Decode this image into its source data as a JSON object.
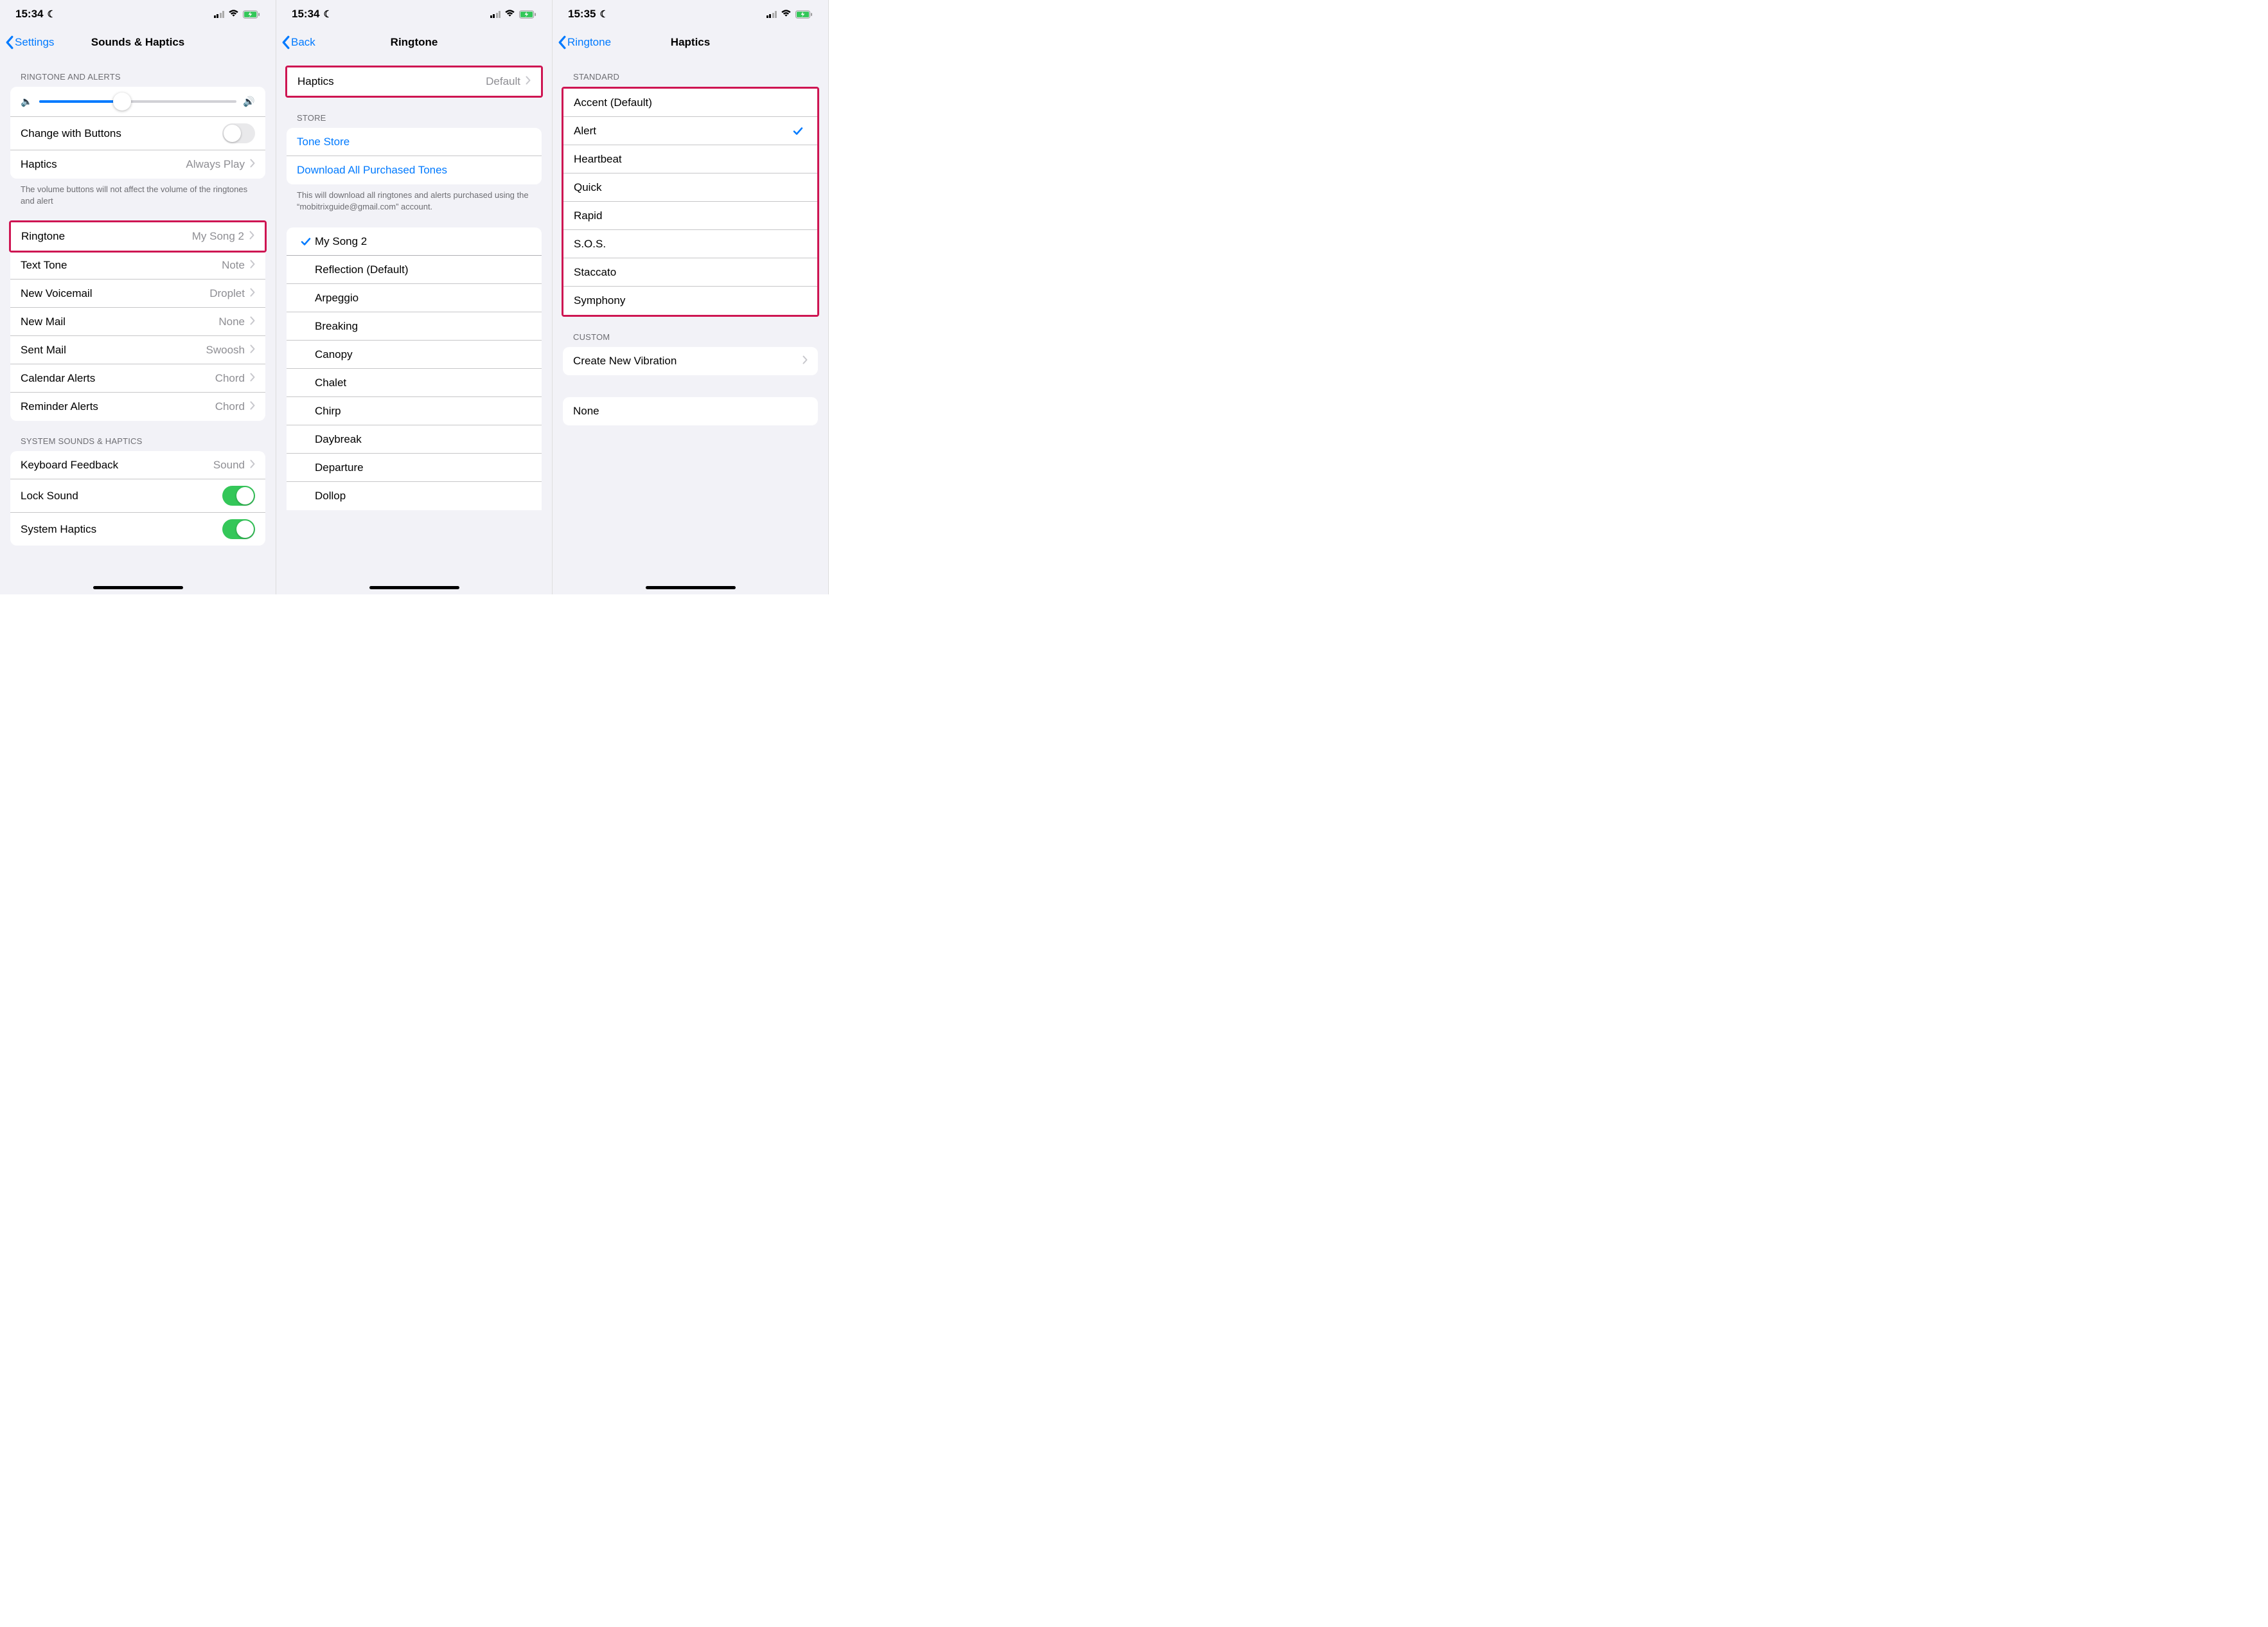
{
  "screen1": {
    "time": "15:34",
    "back_label": "Settings",
    "title": "Sounds & Haptics",
    "section1_header": "RINGTONE AND ALERTS",
    "slider_pct": 42,
    "change_buttons_label": "Change with Buttons",
    "change_buttons_on": false,
    "haptics_label": "Haptics",
    "haptics_value": "Always Play",
    "footer1": "The volume buttons will not affect the volume of the ringtones and alert",
    "sounds": [
      {
        "label": "Ringtone",
        "value": "My Song 2",
        "highlighted": true
      },
      {
        "label": "Text Tone",
        "value": "Note"
      },
      {
        "label": "New Voicemail",
        "value": "Droplet"
      },
      {
        "label": "New Mail",
        "value": "None"
      },
      {
        "label": "Sent Mail",
        "value": "Swoosh"
      },
      {
        "label": "Calendar Alerts",
        "value": "Chord"
      },
      {
        "label": "Reminder Alerts",
        "value": "Chord"
      }
    ],
    "section3_header": "SYSTEM SOUNDS & HAPTICS",
    "keyboard_label": "Keyboard Feedback",
    "keyboard_value": "Sound",
    "lock_sound_label": "Lock Sound",
    "lock_sound_on": true,
    "system_haptics_label": "System Haptics",
    "system_haptics_on": true
  },
  "screen2": {
    "time": "15:34",
    "back_label": "Back",
    "title": "Ringtone",
    "haptics_label": "Haptics",
    "haptics_value": "Default",
    "store_header": "STORE",
    "tone_store_label": "Tone Store",
    "download_label": "Download All Purchased Tones",
    "store_footer": "This will download all ringtones and alerts purchased using the “mobitrixguide@gmail.com” account.",
    "tones": [
      {
        "label": "My Song 2",
        "selected": true
      },
      {
        "label": "Reflection (Default)"
      },
      {
        "label": "Arpeggio"
      },
      {
        "label": "Breaking"
      },
      {
        "label": "Canopy"
      },
      {
        "label": "Chalet"
      },
      {
        "label": "Chirp"
      },
      {
        "label": "Daybreak"
      },
      {
        "label": "Departure"
      },
      {
        "label": "Dollop"
      }
    ]
  },
  "screen3": {
    "time": "15:35",
    "back_label": "Ringtone",
    "title": "Haptics",
    "standard_header": "STANDARD",
    "standard": [
      {
        "label": "Accent (Default)"
      },
      {
        "label": "Alert",
        "selected": true
      },
      {
        "label": "Heartbeat"
      },
      {
        "label": "Quick"
      },
      {
        "label": "Rapid"
      },
      {
        "label": "S.O.S."
      },
      {
        "label": "Staccato"
      },
      {
        "label": "Symphony"
      }
    ],
    "custom_header": "CUSTOM",
    "create_label": "Create New Vibration",
    "none_label": "None"
  }
}
